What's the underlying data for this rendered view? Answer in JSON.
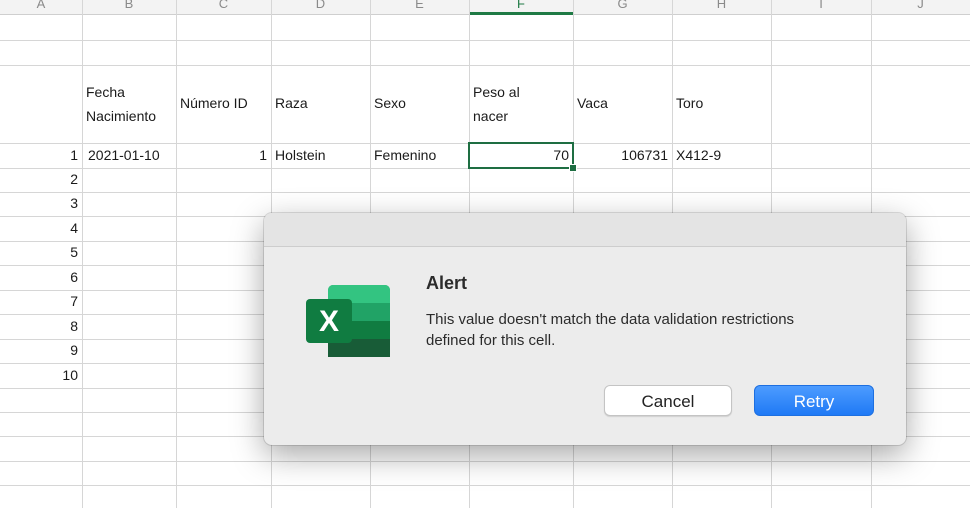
{
  "columns": {
    "headers": [
      "A",
      "B",
      "C",
      "D",
      "E",
      "F",
      "G",
      "H",
      "I",
      "J"
    ],
    "active": "F"
  },
  "table": {
    "headers": {
      "fecha_line1": "Fecha",
      "fecha_line2": "Nacimiento",
      "numero_id": "Número ID",
      "raza": "Raza",
      "sexo": "Sexo",
      "peso_line1": "Peso al",
      "peso_line2": "nacer",
      "vaca": "Vaca",
      "toro": "Toro"
    },
    "row_numbers": [
      "1",
      "2",
      "3",
      "4",
      "5",
      "6",
      "7",
      "8",
      "9",
      "10"
    ],
    "row1": {
      "fecha": "2021-01-10",
      "numero_id": "1",
      "raza": "Holstein",
      "sexo": "Femenino",
      "peso": "70",
      "vaca": "106731",
      "toro": "X412-9"
    }
  },
  "dialog": {
    "title": "Alert",
    "message": "This value doesn't match the data validation restrictions defined for this cell.",
    "cancel_label": "Cancel",
    "retry_label": "Retry",
    "icon": "excel-app-icon",
    "icon_letter": "X"
  },
  "colors": {
    "accent_green": "#1e6e42",
    "retry_blue": "#1f79f5"
  }
}
